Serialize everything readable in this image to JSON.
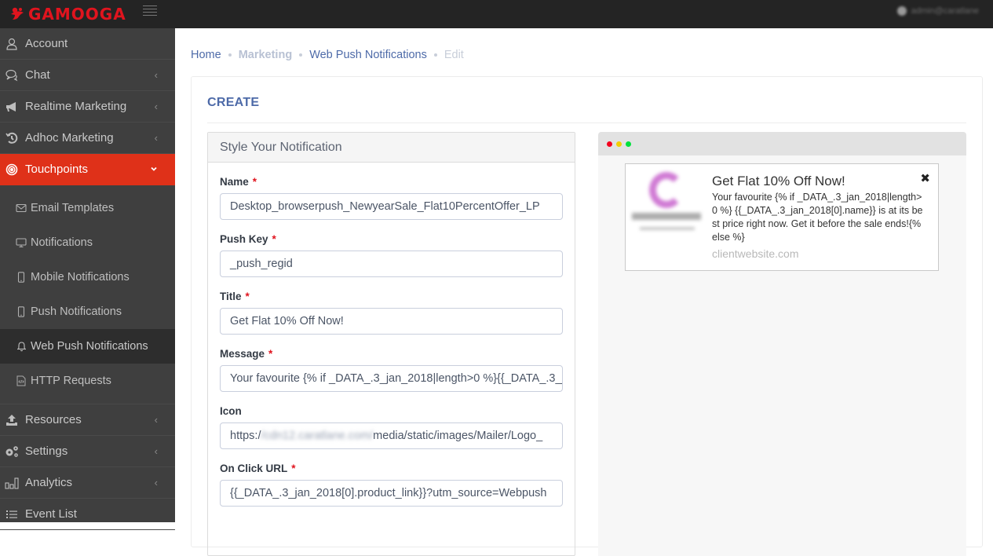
{
  "brand": {
    "name": "GAMOOGA",
    "color": "#e0141e"
  },
  "topbar": {
    "menu_icon": "hamburger-icon",
    "user_name": "admin@caratlane"
  },
  "sidebar": {
    "items": [
      {
        "label": "Account",
        "icon": "user-icon",
        "has_chevron": false
      },
      {
        "label": "Chat",
        "icon": "chat-icon",
        "has_chevron": true
      },
      {
        "label": "Realtime Marketing",
        "icon": "megaphone-icon",
        "has_chevron": true
      },
      {
        "label": "Adhoc Marketing",
        "icon": "history-icon",
        "has_chevron": true
      },
      {
        "label": "Touchpoints",
        "icon": "target-icon",
        "has_chevron": true,
        "expanded": true,
        "active": true
      }
    ],
    "sub_items": [
      {
        "label": "Email Templates",
        "icon": "envelope-icon"
      },
      {
        "label": "Notifications",
        "icon": "monitor-icon"
      },
      {
        "label": "Mobile Notifications",
        "icon": "mobile-icon"
      },
      {
        "label": "Push Notifications",
        "icon": "mobile-icon"
      },
      {
        "label": "Web Push Notifications",
        "icon": "bell-icon",
        "current": true
      },
      {
        "label": "HTTP Requests",
        "icon": "code-file-icon"
      }
    ],
    "items_after": [
      {
        "label": "Resources",
        "icon": "upload-icon",
        "has_chevron": true
      },
      {
        "label": "Settings",
        "icon": "gears-icon",
        "has_chevron": true
      },
      {
        "label": "Analytics",
        "icon": "bar-chart-icon",
        "has_chevron": true
      },
      {
        "label": "Event List",
        "icon": "list-icon",
        "has_chevron": false
      }
    ],
    "active_color": "#df3119"
  },
  "breadcrumb": {
    "items": [
      "Home",
      "Marketing",
      "Web Push Notifications",
      "Edit"
    ]
  },
  "card": {
    "title": "CREATE"
  },
  "form": {
    "panel_title": "Style Your Notification",
    "fields": {
      "name": {
        "label": "Name",
        "required": "*",
        "value": "Desktop_browserpush_NewyearSale_Flat10PercentOffer_LP"
      },
      "push_key": {
        "label": "Push Key",
        "required": "*",
        "value": "_push_regid"
      },
      "title": {
        "label": "Title",
        "required": "*",
        "value": "Get Flat 10% Off Now!"
      },
      "message": {
        "label": "Message",
        "required": "*",
        "value": "Your favourite {% if _DATA_.3_jan_2018|length>0 %}{{_DATA_.3_jan_2018[0].name}} is at its best price right now. Get it before the sale ends!{% else %}"
      },
      "icon": {
        "label": "Icon",
        "value_prefix": "https:/",
        "value_hidden": "/cdn12.caratlane.com/",
        "value_suffix": "media/static/images/Mailer/Logo_"
      },
      "on_click_url": {
        "label": "On Click URL",
        "required": "*",
        "value": "{{_DATA_.3_jan_2018[0].product_link}}?utm_source=Webpush"
      }
    }
  },
  "preview": {
    "title": "Get Flat 10% Off Now!",
    "body": "Your favourite {% if _DATA_.3_jan_2018|length>0 %} {{_DATA_.3_jan_2018[0].name}} is at its best price right now. Get it before the sale ends!{% else %}",
    "site": "clientwebsite.com",
    "close_glyph": "✖",
    "traffic_colors": [
      "#f4001e",
      "#f3cf00",
      "#00e13c"
    ]
  }
}
